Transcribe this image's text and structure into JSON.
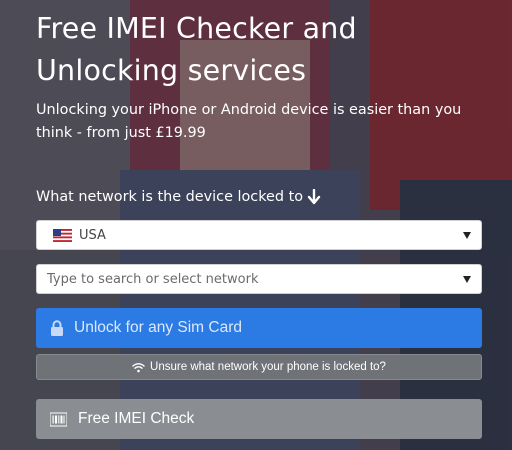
{
  "hero": {
    "title": "Free IMEI Checker and Unlocking services",
    "subtitle": "Unlocking your iPhone or Android device is easier than you think - from just £19.99"
  },
  "form": {
    "network_label": "What network is the device locked to",
    "network_label_icon": "arrow-down-icon",
    "country_select": {
      "selected": "USA",
      "icon": "us-flag-icon"
    },
    "network_select": {
      "placeholder": "Type to search or select network"
    },
    "unlock_button": {
      "label": "Unlock for any Sim Card",
      "icon": "lock-icon"
    },
    "unsure_button": {
      "label": "Unsure what network your phone is locked to?",
      "icon": "wifi-icon"
    },
    "imei_button": {
      "label": "Free IMEI Check",
      "icon": "barcode-icon"
    }
  },
  "colors": {
    "primary_button": "#2c7be5",
    "secondary_button": "#6f7378",
    "imei_button": "#8a8d91",
    "text": "#ffffff"
  }
}
